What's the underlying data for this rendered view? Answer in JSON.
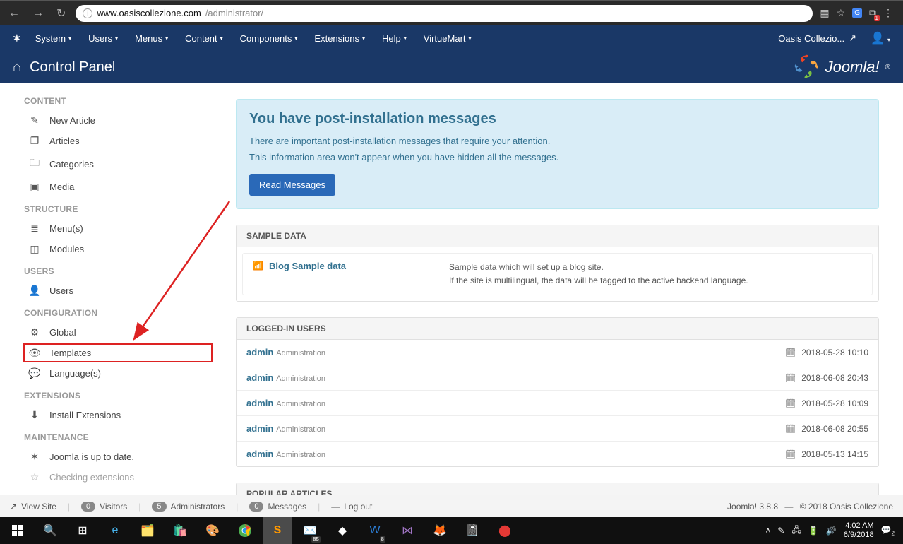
{
  "browser": {
    "url_host": "www.oasiscollezione.com",
    "url_path": "/administrator/"
  },
  "nav": {
    "items": [
      "System",
      "Users",
      "Menus",
      "Content",
      "Components",
      "Extensions",
      "Help",
      "VirtueMart"
    ],
    "site_name": "Oasis Collezio..."
  },
  "header": {
    "title": "Control Panel",
    "logo_text": "Joomla!"
  },
  "sidebar": {
    "sections": [
      {
        "heading": "CONTENT",
        "items": [
          {
            "label": "New Article",
            "icon": "✎"
          },
          {
            "label": "Articles",
            "icon": "❐"
          },
          {
            "label": "Categories",
            "icon": "🗀"
          },
          {
            "label": "Media",
            "icon": "▣"
          }
        ]
      },
      {
        "heading": "STRUCTURE",
        "items": [
          {
            "label": "Menu(s)",
            "icon": "≣"
          },
          {
            "label": "Modules",
            "icon": "◫"
          }
        ]
      },
      {
        "heading": "USERS",
        "items": [
          {
            "label": "Users",
            "icon": "👤"
          }
        ]
      },
      {
        "heading": "CONFIGURATION",
        "items": [
          {
            "label": "Global",
            "icon": "⚙"
          },
          {
            "label": "Templates",
            "icon": "👁",
            "highlighted": true
          },
          {
            "label": "Language(s)",
            "icon": "💬"
          }
        ]
      },
      {
        "heading": "EXTENSIONS",
        "items": [
          {
            "label": "Install Extensions",
            "icon": "⬇"
          }
        ]
      },
      {
        "heading": "MAINTENANCE",
        "items": [
          {
            "label": "Joomla is up to date.",
            "icon": "✶"
          },
          {
            "label": "Checking extensions",
            "icon": "☆"
          }
        ]
      }
    ]
  },
  "post_install": {
    "title": "You have post-installation messages",
    "line1": "There are important post-installation messages that require your attention.",
    "line2": "This information area won't appear when you have hidden all the messages.",
    "button": "Read Messages"
  },
  "sample_data": {
    "heading": "SAMPLE DATA",
    "label": "Blog Sample data",
    "desc1": "Sample data which will set up a blog site.",
    "desc2": "If the site is multilingual, the data will be tagged to the active backend language."
  },
  "logged_in": {
    "heading": "LOGGED-IN USERS",
    "rows": [
      {
        "name": "admin",
        "role": "Administration",
        "time": "2018-05-28 10:10"
      },
      {
        "name": "admin",
        "role": "Administration",
        "time": "2018-06-08 20:43"
      },
      {
        "name": "admin",
        "role": "Administration",
        "time": "2018-05-28 10:09"
      },
      {
        "name": "admin",
        "role": "Administration",
        "time": "2018-06-08 20:55"
      },
      {
        "name": "admin",
        "role": "Administration",
        "time": "2018-05-13 14:15"
      }
    ]
  },
  "popular": {
    "heading": "POPULAR ARTICLES"
  },
  "status": {
    "view_site": "View Site",
    "visitors_count": "0",
    "visitors_label": "Visitors",
    "admins_count": "5",
    "admins_label": "Administrators",
    "messages_count": "0",
    "messages_label": "Messages",
    "logout": "Log out",
    "version": "Joomla! 3.8.8",
    "copyright": "© 2018 Oasis Collezione"
  },
  "taskbar": {
    "time": "4:02 AM",
    "date": "6/9/2018"
  }
}
